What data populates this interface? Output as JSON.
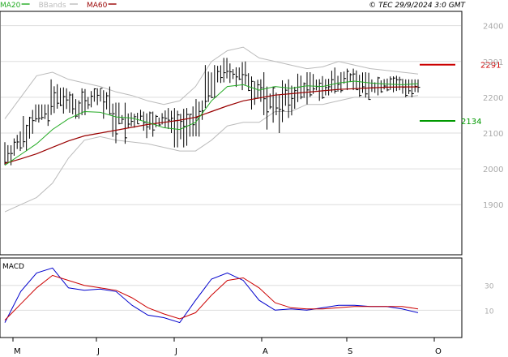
{
  "header": {
    "legend": [
      {
        "label": "MA20",
        "color": "#22aa22",
        "key": "ma20"
      },
      {
        "label": "BBands",
        "color": "#bbbbbb",
        "key": "bbands"
      },
      {
        "label": "MA60",
        "color": "#990000",
        "key": "ma60"
      }
    ],
    "copyright": "© TEC 29/9/2024 3:0 GMT"
  },
  "colors": {
    "bars": "#000000",
    "ma20": "#22aa22",
    "ma60": "#990000",
    "bbands": "#bbbbbb",
    "macd": "#0000cc",
    "signal": "#cc0000",
    "grid": "#dddddd",
    "border": "#000000",
    "resistance": "#cc0000",
    "support": "#009900"
  },
  "chart_data": [
    {
      "type": "ohlc",
      "name": "price",
      "y_ticks": [
        2400,
        2300,
        2200,
        2100,
        2000,
        1900
      ],
      "y_tick_labels": [
        "2400",
        "2291",
        "2200",
        "2100",
        "2000",
        "1900"
      ],
      "ylim": [
        1760,
        2440
      ],
      "grid": true,
      "annotations": [
        {
          "label": "2291",
          "value": 2291,
          "color": "#cc0000"
        },
        {
          "label": "2134",
          "value": 2134,
          "color": "#009900"
        }
      ],
      "ohlc_weekly": [
        [
          2035,
          2095,
          2010,
          2070
        ],
        [
          2070,
          2175,
          2050,
          2150
        ],
        [
          2150,
          2180,
          2120,
          2170
        ],
        [
          2170,
          2250,
          2150,
          2195
        ],
        [
          2195,
          2225,
          2140,
          2165
        ],
        [
          2165,
          2225,
          2150,
          2215
        ],
        [
          2215,
          2230,
          2140,
          2170
        ],
        [
          2170,
          2185,
          2070,
          2125
        ],
        [
          2125,
          2165,
          2095,
          2150
        ],
        [
          2150,
          2160,
          2080,
          2130
        ],
        [
          2130,
          2170,
          2100,
          2150
        ],
        [
          2150,
          2170,
          2060,
          2100
        ],
        [
          2100,
          2200,
          2090,
          2180
        ],
        [
          2180,
          2290,
          2170,
          2270
        ],
        [
          2270,
          2310,
          2240,
          2265
        ],
        [
          2265,
          2300,
          2200,
          2245
        ],
        [
          2245,
          2270,
          2150,
          2200
        ],
        [
          2200,
          2230,
          2100,
          2190
        ],
        [
          2190,
          2250,
          2120,
          2215
        ],
        [
          2215,
          2270,
          2180,
          2235
        ],
        [
          2235,
          2265,
          2190,
          2220
        ],
        [
          2220,
          2290,
          2200,
          2260
        ],
        [
          2260,
          2280,
          2220,
          2245
        ],
        [
          2245,
          2270,
          2190,
          2230
        ],
        [
          2230,
          2260,
          2200,
          2240
        ],
        [
          2240,
          2260,
          2210,
          2235
        ],
        [
          2235,
          2250,
          2200,
          2225
        ]
      ],
      "ma20_points": [
        2010,
        2040,
        2070,
        2110,
        2140,
        2160,
        2158,
        2145,
        2142,
        2130,
        2115,
        2110,
        2130,
        2190,
        2230,
        2235,
        2220,
        2230,
        2225,
        2232,
        2230,
        2240,
        2245,
        2240,
        2237,
        2235,
        2238
      ],
      "ma60_points": [
        2015,
        2028,
        2042,
        2060,
        2078,
        2092,
        2100,
        2108,
        2116,
        2124,
        2130,
        2136,
        2144,
        2160,
        2176,
        2190,
        2198,
        2206,
        2210,
        2214,
        2218,
        2222,
        2224,
        2226,
        2228,
        2229,
        2229
      ],
      "bb_upper_points": [
        2140,
        2200,
        2260,
        2270,
        2250,
        2240,
        2230,
        2215,
        2205,
        2190,
        2180,
        2190,
        2230,
        2300,
        2330,
        2340,
        2310,
        2300,
        2290,
        2280,
        2285,
        2300,
        2290,
        2280,
        2275,
        2270,
        2265
      ],
      "bb_lower_points": [
        1880,
        1900,
        1920,
        1960,
        2030,
        2080,
        2090,
        2080,
        2075,
        2070,
        2060,
        2050,
        2050,
        2080,
        2120,
        2130,
        2130,
        2160,
        2160,
        2180,
        2180,
        2190,
        2200,
        2200,
        2200,
        2200,
        2205
      ]
    },
    {
      "type": "line",
      "name": "MACD",
      "title": "MACD",
      "y_ticks": [
        30,
        10
      ],
      "y_tick_labels": [
        "30",
        "10"
      ],
      "ylim": [
        -12,
        52
      ],
      "grid": true,
      "x_labels": [
        "M",
        "J",
        "J",
        "A",
        "S",
        "O"
      ],
      "series": [
        {
          "key": "macd",
          "color": "#0000cc",
          "values": [
            0,
            25,
            40,
            44,
            28,
            26,
            27,
            25,
            14,
            6,
            4,
            0,
            18,
            35,
            40,
            34,
            18,
            10,
            11,
            10,
            12,
            14,
            14,
            13,
            13,
            11,
            8
          ]
        },
        {
          "key": "signal",
          "color": "#cc0000",
          "values": [
            2,
            15,
            28,
            38,
            34,
            30,
            28,
            26,
            20,
            12,
            7,
            3,
            8,
            22,
            34,
            36,
            28,
            16,
            12,
            11,
            11,
            12,
            13,
            13,
            13,
            13,
            11
          ]
        }
      ]
    }
  ]
}
